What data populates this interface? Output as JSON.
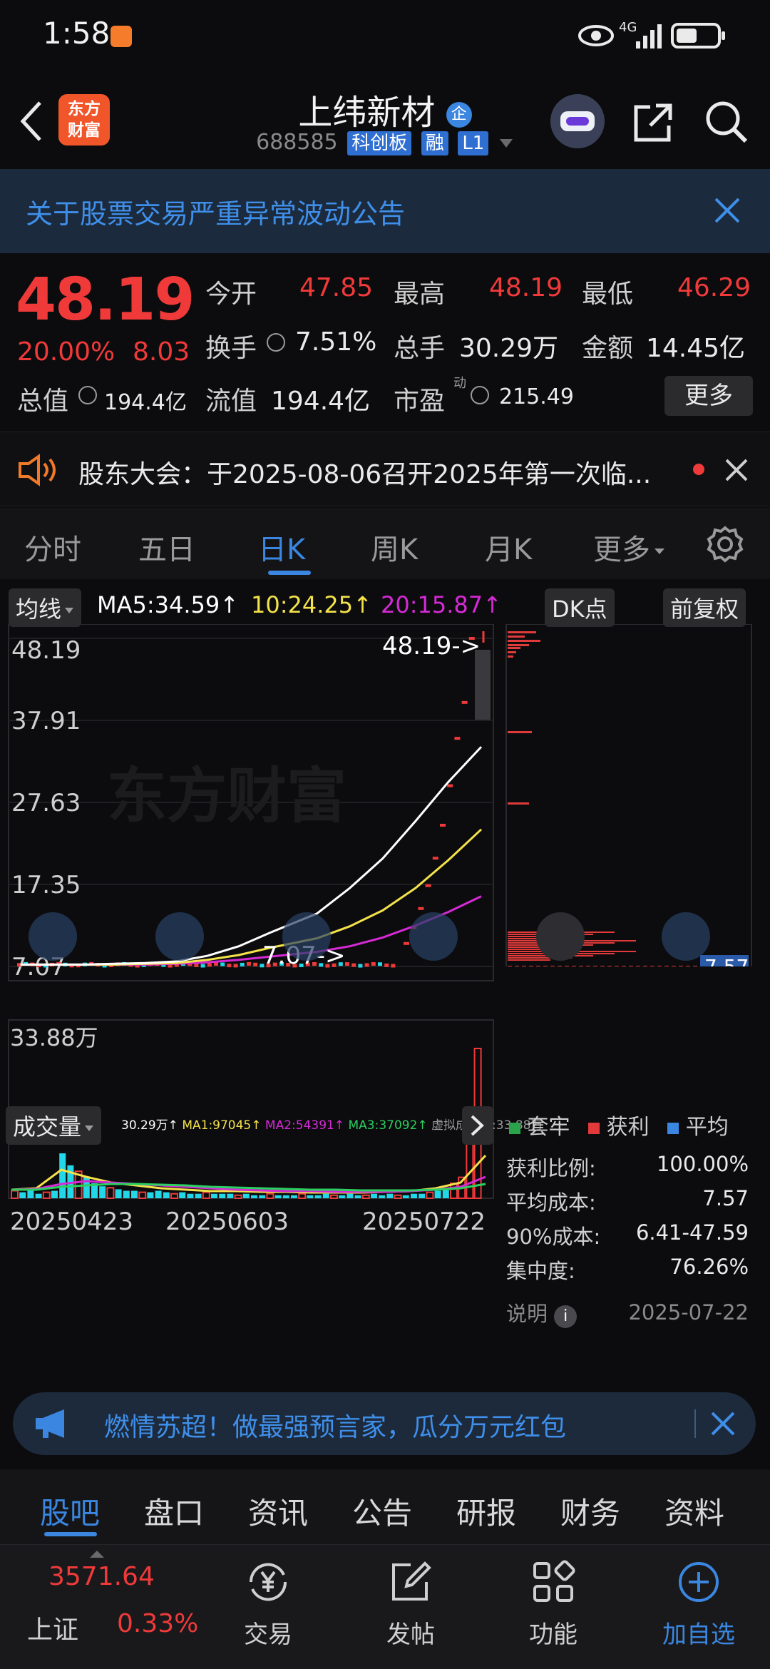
{
  "status": {
    "time": "1:58",
    "network": "4G"
  },
  "header": {
    "brand_line1": "东方",
    "brand_line2": "财富",
    "stock_name": "上纬新材",
    "badge": "企",
    "code": "688585",
    "tags": [
      "科创板",
      "融",
      "L1"
    ]
  },
  "notice": {
    "text": "关于股票交易严重异常波动公告"
  },
  "quote": {
    "price": "48.19",
    "change_pct": "20.00%",
    "change_amt": "8.03",
    "open_label": "今开",
    "open": "47.85",
    "high_label": "最高",
    "high": "48.19",
    "low_label": "最低",
    "low": "46.29",
    "turnover_label": "换手",
    "turnover": "7.51%",
    "volume_label": "总手",
    "volume": "30.29万",
    "amount_label": "金额",
    "amount": "14.45亿",
    "mktcap_label": "总值",
    "mktcap": "194.4亿",
    "float_label": "流值",
    "float": "194.4亿",
    "pe_label": "市盈",
    "pe_sup": "动",
    "pe": "215.49",
    "more_label": "更多"
  },
  "meeting": {
    "text": "股东大会：于2025-08-06召开2025年第一次临..."
  },
  "ktabs": {
    "items": [
      "分时",
      "五日",
      "日K",
      "周K",
      "月K",
      "更多"
    ],
    "active": "日K"
  },
  "chart_controls": {
    "ma_select": "均线",
    "ma5": "MA5:34.59↑",
    "ma10": "10:24.25↑",
    "ma20": "20:15.87↑",
    "dk_label": "DK点",
    "adjust_label": "前复权",
    "watermark": "东方财富",
    "vol_select": "成交量",
    "vol_info": "30.29万↑",
    "vol_ma1": "MA1:97045↑",
    "vol_ma2": "MA2:54391↑",
    "vol_ma3": "MA3:37092↑",
    "vol_virtual": "虚拟成交量:33.88万"
  },
  "chart_data": {
    "type": "candlestick",
    "y_ticks": [
      "48.19",
      "37.91",
      "27.63",
      "17.35",
      "7.07"
    ],
    "ylim": [
      7.07,
      48.19
    ],
    "max_label": "48.19->",
    "min_label": "7.07->",
    "x_ticks": [
      "20250423",
      "20250603",
      "20250722"
    ],
    "vol_max_label": "33.88万",
    "ma5": [
      7.3,
      7.3,
      7.3,
      7.4,
      7.5,
      7.7,
      8.4,
      9.6,
      11.3,
      13.7,
      16.9,
      20.6,
      25.3,
      30.2,
      34.59
    ],
    "ma10": [
      7.3,
      7.3,
      7.3,
      7.3,
      7.4,
      7.5,
      7.9,
      8.5,
      9.4,
      10.6,
      12.1,
      14.1,
      16.9,
      20.4,
      24.25
    ],
    "ma20": [
      7.3,
      7.3,
      7.3,
      7.3,
      7.3,
      7.4,
      7.6,
      7.9,
      8.3,
      8.9,
      9.6,
      10.7,
      12.2,
      13.9,
      15.87
    ],
    "recent_closes": [
      9.95,
      11.94,
      14.33,
      17.2,
      20.64,
      24.77,
      29.72,
      35.66,
      40.16,
      48.19
    ],
    "chip_cost_line": "7.57"
  },
  "chip": {
    "legend": [
      "套牢",
      "获利",
      "平均"
    ],
    "legend_colors": [
      "#2aa34a",
      "#e03a3a",
      "#3a86e0"
    ],
    "profit_ratio_label": "获利比例:",
    "profit_ratio": "100.00%",
    "avg_cost_label": "平均成本:",
    "avg_cost": "7.57",
    "cost90_label": "90%成本:",
    "cost90": "6.41-47.59",
    "concentration_label": "集中度:",
    "concentration": "76.26%",
    "note_label": "说明",
    "date": "2025-07-22"
  },
  "banner": {
    "text": "燃情苏超！做最强预言家，瓜分万元红包"
  },
  "section_tabs": {
    "items": [
      "股吧",
      "盘口",
      "资讯",
      "公告",
      "研报",
      "财务",
      "资料"
    ],
    "active": "股吧"
  },
  "bottom_nav": {
    "index_value": "3571.64",
    "index_name": "上证",
    "index_change": "0.33%",
    "items": [
      "交易",
      "发帖",
      "功能",
      "加自选"
    ]
  },
  "colors": {
    "up": "#f03a3a",
    "accent": "#3a86e0",
    "ma5": "#ffffff",
    "ma10": "#f3e24a",
    "ma20": "#d62ad6",
    "vol_bar": "#22d8e8"
  }
}
